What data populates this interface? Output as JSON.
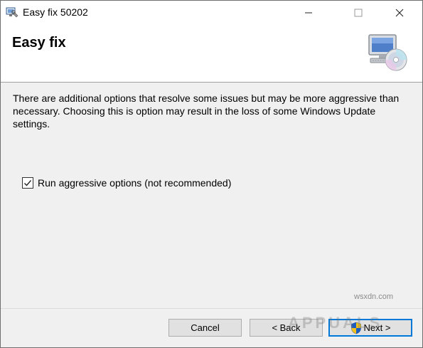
{
  "window": {
    "title": "Easy fix 50202",
    "controls": [
      "minimize-icon",
      "maximize-icon",
      "close-icon"
    ]
  },
  "header": {
    "title": "Easy fix",
    "icon": "computer-disc-icon"
  },
  "body": {
    "description": "There are additional options that resolve some issues but may be more aggressive than necessary. Choosing this is option may result in the loss of some Windows Update settings.",
    "checkbox": {
      "label": "Run aggressive options (not recommended)",
      "checked": true
    }
  },
  "footer": {
    "cancel_label": "Cancel",
    "back_label": "< Back",
    "next_label": "Next >",
    "next_icon": "uac-shield-icon"
  },
  "watermarks": {
    "site": "wsxdn.com",
    "brand": "APPUALS"
  },
  "colors": {
    "accent": "#0078d7",
    "dialog_bg": "#f0f0f0",
    "header_bg": "#ffffff"
  }
}
